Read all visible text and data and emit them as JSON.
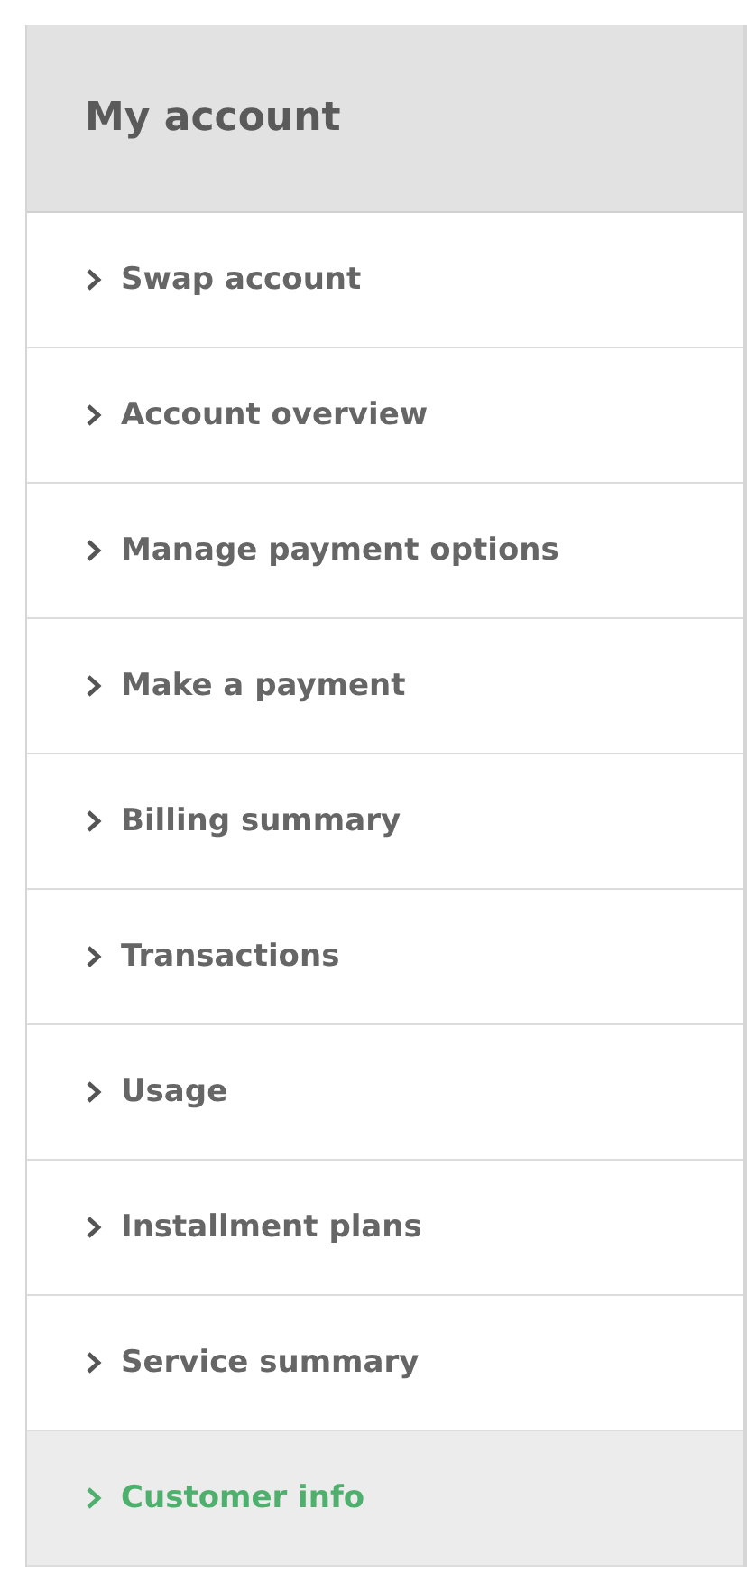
{
  "sidebar": {
    "title": "My account",
    "items": [
      {
        "label": "Swap account",
        "selected": false
      },
      {
        "label": "Account overview",
        "selected": false
      },
      {
        "label": "Manage payment options",
        "selected": false
      },
      {
        "label": "Make a payment",
        "selected": false
      },
      {
        "label": "Billing summary",
        "selected": false
      },
      {
        "label": "Transactions",
        "selected": false
      },
      {
        "label": "Usage",
        "selected": false
      },
      {
        "label": "Installment plans",
        "selected": false
      },
      {
        "label": "Service summary",
        "selected": false
      },
      {
        "label": "Customer info",
        "selected": true
      }
    ]
  }
}
